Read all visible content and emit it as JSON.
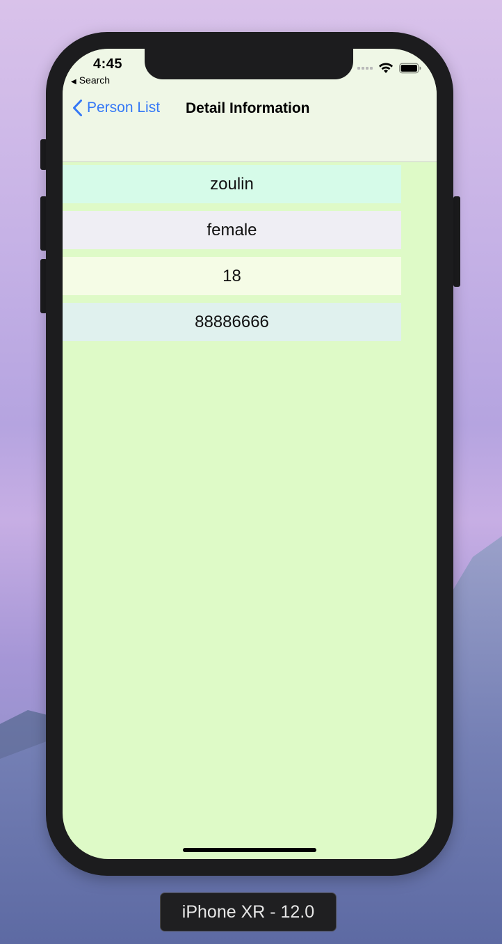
{
  "status_bar": {
    "time": "4:45",
    "back_app": "Search",
    "icons": [
      "cellular-signal-icon",
      "wifi-icon",
      "battery-icon"
    ]
  },
  "nav": {
    "back_label": "Person List",
    "title": "Detail Information",
    "accent_color": "#3478f6"
  },
  "details": {
    "name": "zoulin",
    "gender": "female",
    "age": "18",
    "phone": "88886666"
  },
  "row_colors": [
    "#d6fbe9",
    "#efeef4",
    "#f5fce6",
    "#e0f1ee"
  ],
  "screen_background": "#defac7",
  "device_label": "iPhone XR - 12.0"
}
